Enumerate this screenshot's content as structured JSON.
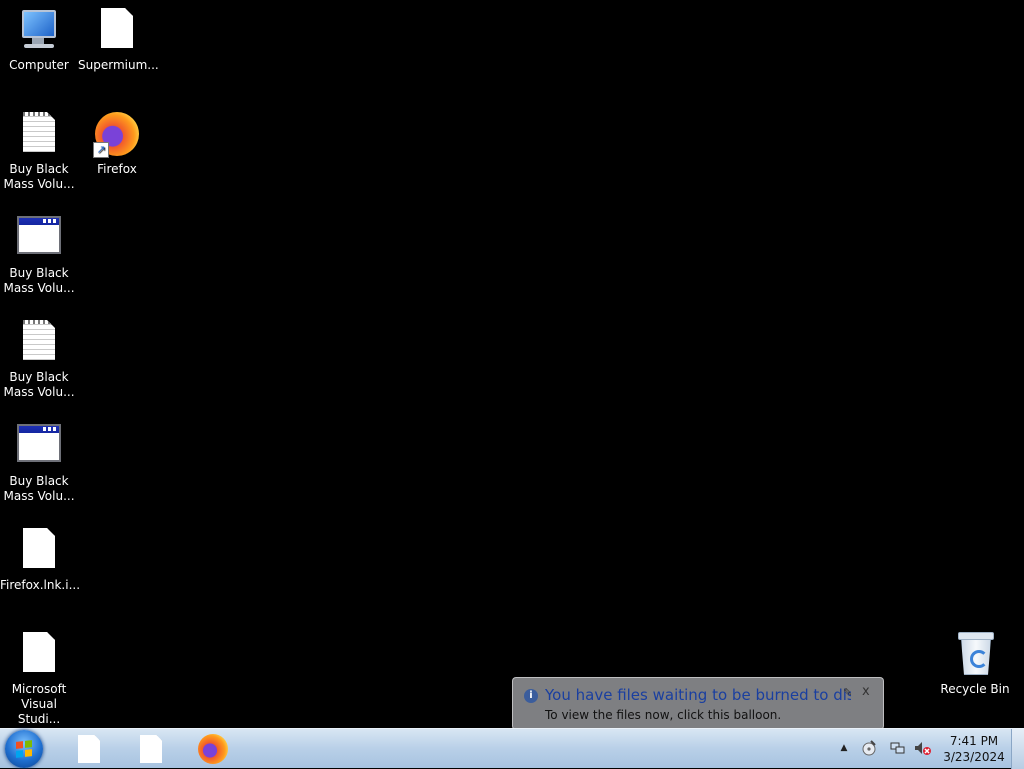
{
  "desktop": {
    "icons": [
      {
        "label": "Computer",
        "icon": "computer-icon"
      },
      {
        "label": "Supermium...",
        "icon": "blank-document-icon"
      },
      {
        "label": "Buy Black\nMass Volu...",
        "icon": "text-document-icon"
      },
      {
        "label": "Firefox",
        "icon": "firefox-shortcut-icon"
      },
      {
        "label": "Buy Black\nMass Volu...",
        "icon": "application-window-icon"
      },
      {
        "label": "Buy Black\nMass Volu...",
        "icon": "text-document-icon"
      },
      {
        "label": "Buy Black\nMass Volu...",
        "icon": "application-window-icon"
      },
      {
        "label": "Firefox.lnk.i...",
        "icon": "blank-document-icon"
      },
      {
        "label": "Microsoft\nVisual Studi...",
        "icon": "blank-document-icon"
      },
      {
        "label": "Recycle Bin",
        "icon": "recycle-bin-icon"
      }
    ]
  },
  "balloon": {
    "title": "You have files waiting to be burned to disc",
    "message": "To view the files now, click this balloon.",
    "info_glyph": "i",
    "options_glyph": "✎",
    "close_glyph": "x"
  },
  "taskbar": {
    "pinned": [
      "blank-document-icon",
      "blank-document-icon",
      "firefox-icon"
    ],
    "tray": {
      "show_hidden_glyph": "▲",
      "time": "7:41 PM",
      "date": "3/23/2024"
    }
  }
}
